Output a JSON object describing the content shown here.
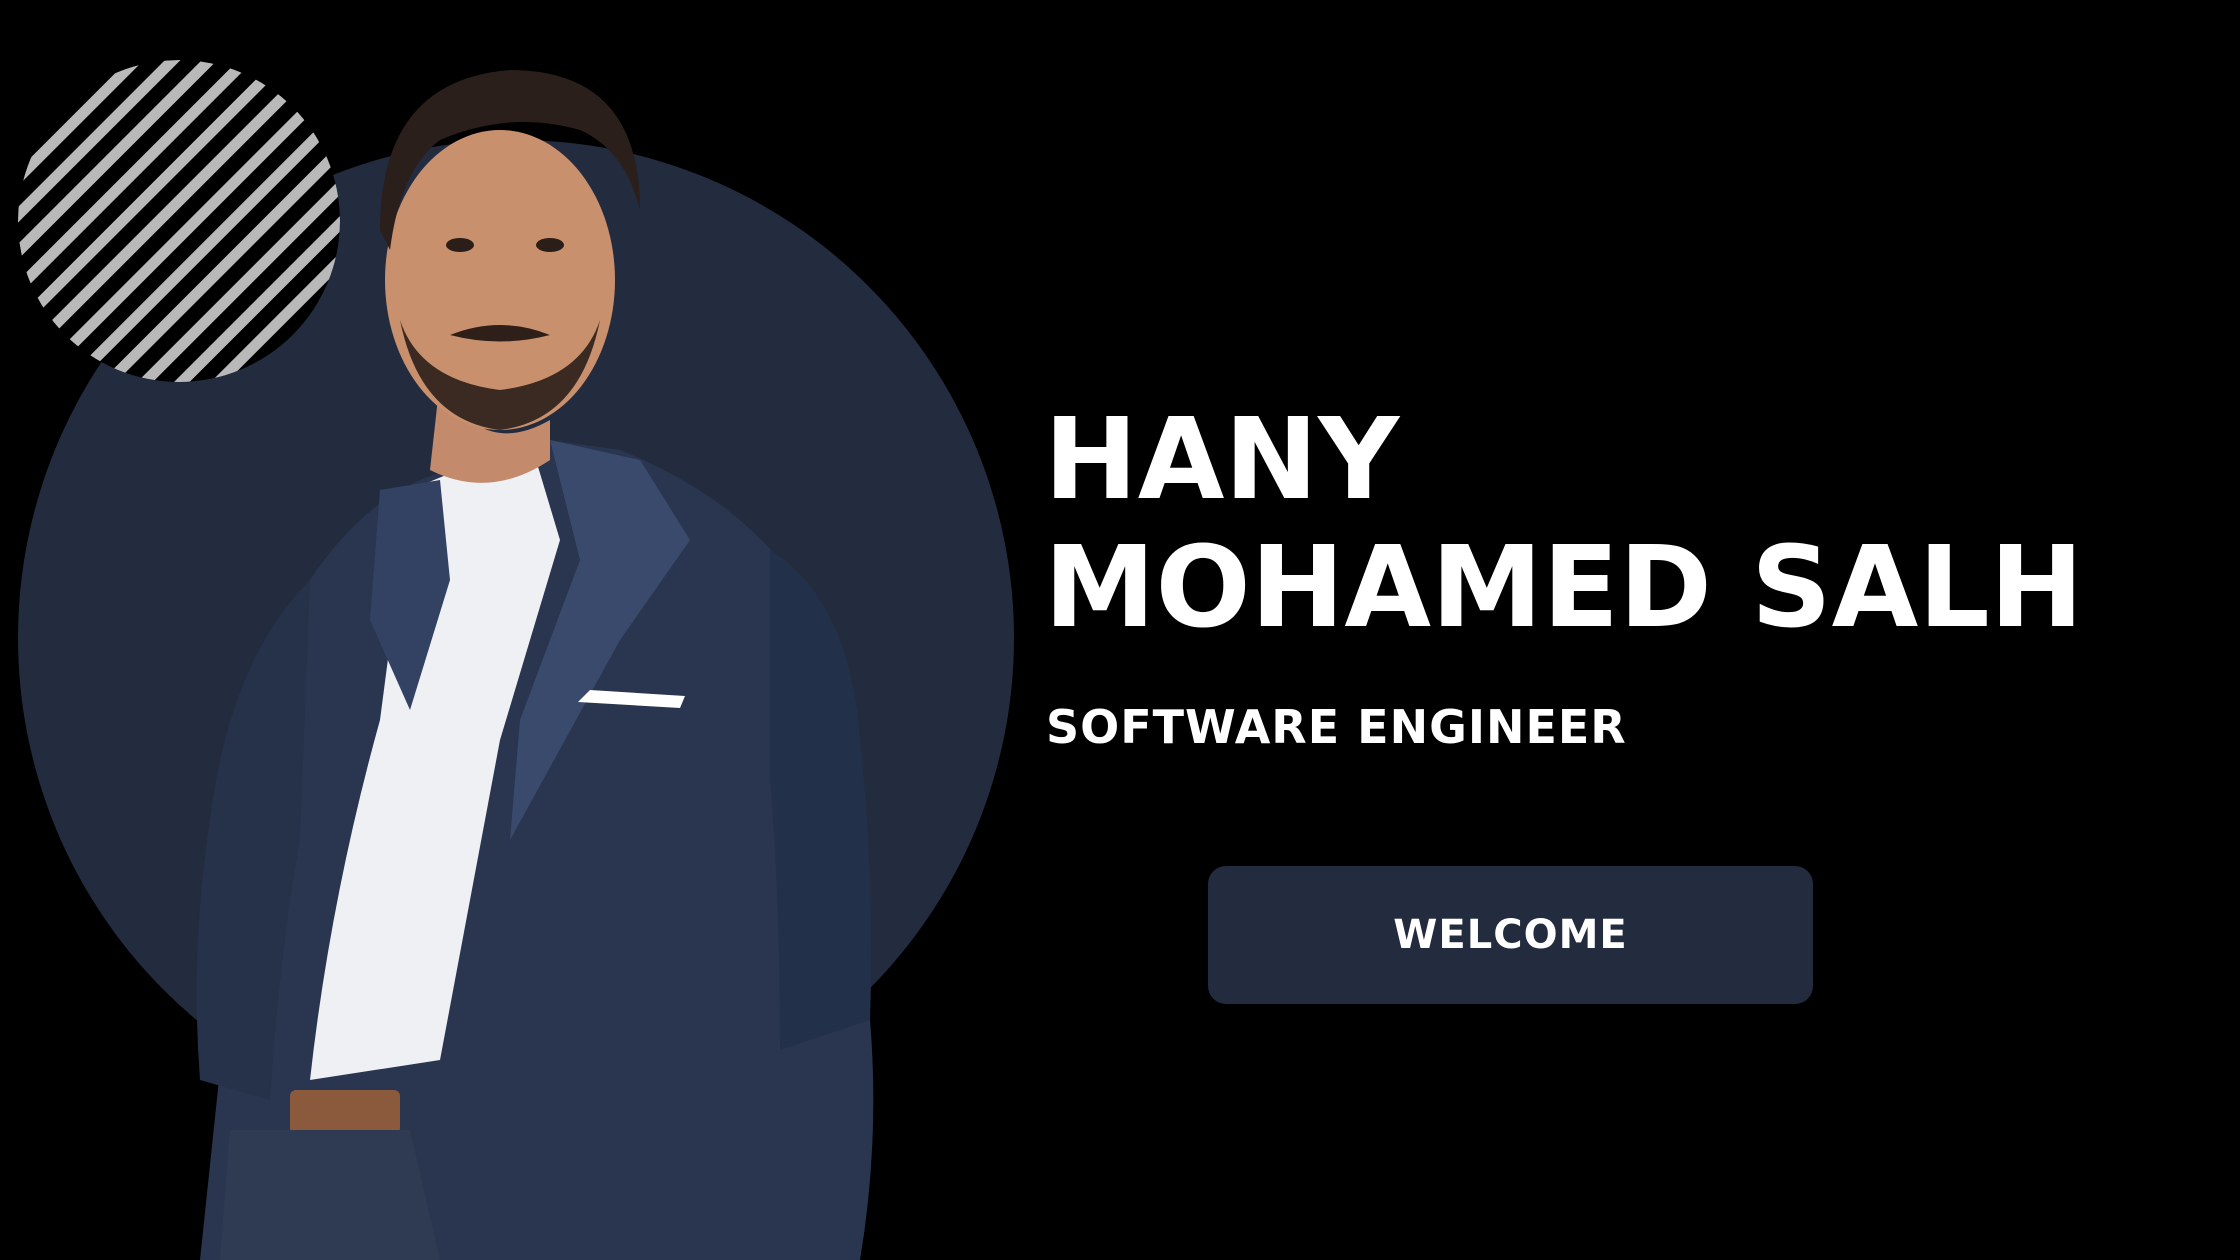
{
  "hero": {
    "name_line_1": "HANY",
    "name_line_2": "MOHAMED SALH",
    "job_title": "SOFTWARE ENGINEER",
    "welcome_label": "WELCOME"
  },
  "colors": {
    "background": "#000000",
    "accent_navy": "#232b3e",
    "text": "#ffffff",
    "stripe_light": "#b9b9b9"
  },
  "icons": {
    "decor": "striped-circle-icon"
  }
}
